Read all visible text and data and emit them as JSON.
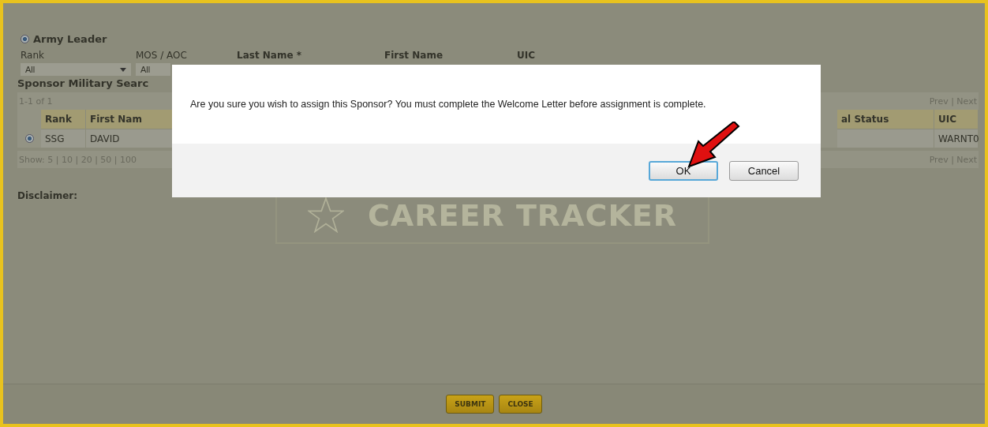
{
  "filter": {
    "option": {
      "label": "Army Leader",
      "selected": true
    },
    "fields": [
      {
        "label": "Rank",
        "kind": "select",
        "value": "All"
      },
      {
        "label": "MOS / AOC",
        "kind": "select",
        "value": "All"
      },
      {
        "label": "Last Name *",
        "kind": "label"
      },
      {
        "label": "First Name",
        "kind": "label"
      },
      {
        "label": "UIC",
        "kind": "label"
      }
    ]
  },
  "results": {
    "title": "Sponsor Military Searc",
    "range": "1-1 of 1",
    "pager_top": "Prev | Next",
    "columns_left": [
      "Rank",
      "First Nam"
    ],
    "columns_right": [
      "al Status",
      "UIC"
    ],
    "rows": [
      {
        "selected": true,
        "rank": "SSG",
        "first_name": "DAVID",
        "uic": "WARNT0"
      }
    ],
    "show": "Show: 5 | 10 | 20 | 50 | 100",
    "pager_bottom": "Prev | Next"
  },
  "disclaimer": "Disclaimer:",
  "logo": {
    "text": "CAREER TRACKER"
  },
  "dialog": {
    "message": "Are you sure you wish to assign this Sponsor? You must complete the Welcome Letter before assignment is complete.",
    "buttons": [
      {
        "label": "OK",
        "focused": true
      },
      {
        "label": "Cancel",
        "focused": false
      }
    ]
  },
  "footer_buttons": [
    "SUBMIT",
    "CLOSE"
  ]
}
